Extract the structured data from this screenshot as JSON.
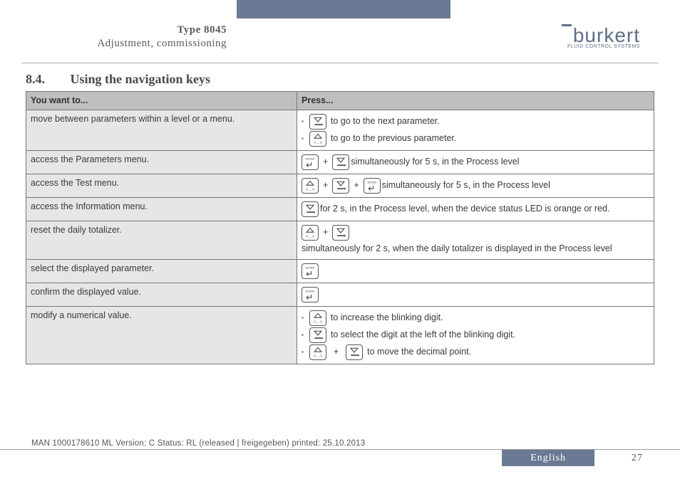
{
  "header": {
    "type": "Type 8045",
    "sub": "Adjustment, commissioning",
    "brand": "burkert",
    "brand_sub": "FLUID CONTROL SYSTEMS"
  },
  "section": {
    "num": "8.4.",
    "title": "Using the navigation keys"
  },
  "table": {
    "th_left": "You want to...",
    "th_right": "Press...",
    "rows": [
      {
        "left": "move between parameters within a level or a menu.",
        "right_bullets": [
          {
            "key": "down",
            "text": " to go to the next parameter."
          },
          {
            "key": "up",
            "text": " to go to the previous parameter."
          }
        ]
      },
      {
        "left": "access the Parameters menu.",
        "right_line": {
          "keys": [
            "enter",
            "down"
          ],
          "text": " simultaneously for 5 s, in the Process level"
        }
      },
      {
        "left": "access the Test menu.",
        "right_line": {
          "keys": [
            "up",
            "down",
            "enter"
          ],
          "text": " simultaneously for 5 s, in the Process level"
        }
      },
      {
        "left": "access the Information menu.",
        "right_line": {
          "keys": [
            "down"
          ],
          "text": " for 2 s, in the Process level, when the device status LED is orange or red."
        }
      },
      {
        "left": "reset the daily totalizer.",
        "right_line": {
          "keys": [
            "up",
            "down"
          ],
          "text": " simultaneously for 2 s, when the daily totalizer is displayed in the Process level"
        }
      },
      {
        "left": "select the displayed parameter.",
        "right_line": {
          "keys": [
            "enter"
          ],
          "text": ""
        }
      },
      {
        "left": "confirm the displayed value.",
        "right_line": {
          "keys": [
            "enter"
          ],
          "text": ""
        }
      },
      {
        "left": "modify a numerical value.",
        "right_bullets": [
          {
            "key": "up",
            "text": " to increase the blinking digit."
          },
          {
            "key": "down",
            "text": " to select the digit at the left of the blinking digit."
          },
          {
            "keys": [
              "up",
              "down"
            ],
            "text": " to move the decimal point."
          }
        ]
      }
    ]
  },
  "footer_status": "MAN 1000178610 ML Version: C Status: RL (released | freigegeben) printed: 25.10.2013",
  "lang": "English",
  "page": "27",
  "key_labels": {
    "up": "0......9",
    "down": "",
    "enter": "ENTER"
  }
}
